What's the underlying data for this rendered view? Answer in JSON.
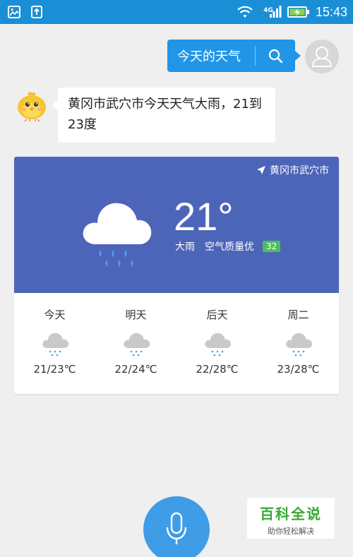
{
  "status_bar": {
    "network": "4G",
    "time": "15:43",
    "colors": {
      "background": "#1a8fd6"
    }
  },
  "chat": {
    "user_query": "今天的天气",
    "answer_line1": "黄冈市武穴市今天天气大雨，21到",
    "answer_line2": "23度"
  },
  "weather": {
    "location": "黄冈市武穴市",
    "temperature": "21°",
    "condition": "大雨",
    "air_quality_label": "空气质量优",
    "aqi": "32",
    "icon": "heavy-rain-cloud-icon",
    "colors": {
      "header": "#4d65b9",
      "aqi_badge": "#4cbe5b",
      "rain": "#4aa3e8"
    },
    "forecast": [
      {
        "day": "今天",
        "temp": "21/23℃",
        "icon": "rain-cloud-icon"
      },
      {
        "day": "明天",
        "temp": "22/24℃",
        "icon": "rain-cloud-icon"
      },
      {
        "day": "后天",
        "temp": "22/28℃",
        "icon": "rain-cloud-icon"
      },
      {
        "day": "周二",
        "temp": "23/28℃",
        "icon": "rain-cloud-icon"
      }
    ]
  },
  "watermark": {
    "title": "百科全说",
    "subtitle": "助你轻松解决"
  }
}
